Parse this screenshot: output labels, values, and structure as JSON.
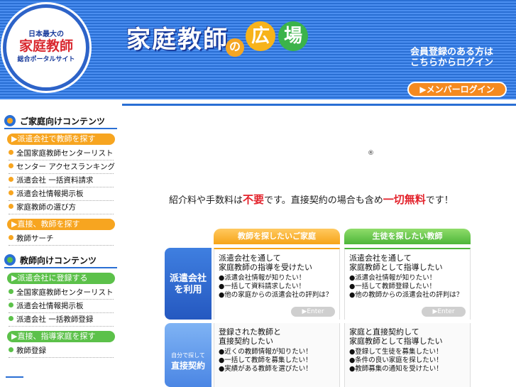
{
  "header": {
    "logo": {
      "top": "日本最大の",
      "main": "家庭教師",
      "sub": "総合ポータルサイト"
    },
    "title": "家庭教師",
    "title_no": "の",
    "title_hiroba": [
      "広",
      "場"
    ],
    "login_msg": [
      "会員登録のある方は",
      "こちらからログイン"
    ],
    "member_login": "▶メンバーログイン"
  },
  "sidebar": {
    "family_section": "ご家庭向けコンテンツ",
    "family_bar1": "▶派遣会社で教師を探す",
    "family_items1": [
      "全国家庭教師センターリスト",
      "センター アクセスランキング",
      "派遣会社 一括資料請求",
      "派遣会社情報掲示板",
      "家庭教師の選び方"
    ],
    "family_bar2": "▶直接、教師を探す",
    "family_items2": [
      "教師サーチ"
    ],
    "teacher_section": "教師向けコンテンツ",
    "teacher_bar1": "▶派遣会社に登録する",
    "teacher_items1": [
      "全国家庭教師センターリスト",
      "派遣会社情報掲示板",
      "派遣会社 一括教師登録"
    ],
    "teacher_bar2": "▶直接、指導家庭を探す",
    "teacher_items2": [
      "教師登録"
    ]
  },
  "main": {
    "reg_mark": "®",
    "headline": {
      "a": "紹介料や手数料は",
      "b": "不要",
      "c": "です。直接契約の場合も含め",
      "d": "一切無料",
      "e": "です！"
    },
    "tab_family": "教師を探したいご家庭",
    "tab_teacher": "生徒を探したい教師",
    "row1_label": [
      "派遣会社",
      "を利用"
    ],
    "row2_label_small": "自分で探して",
    "row2_label_big": "直接契約",
    "c1": {
      "title": [
        "派遣会社を通して",
        "家庭教師の指導を受けたい"
      ],
      "lines": [
        "●派遣会社情報が知りたい！",
        "●一括して資料請求したい！",
        "●他の家庭からの派遣会社の評判は？"
      ],
      "enter": "▶Enter"
    },
    "c2": {
      "title": [
        "派遣会社を通して",
        "家庭教師として指導したい"
      ],
      "lines": [
        "●派遣会社情報が知りたい！",
        "●一括して教師登録したい！",
        "●他の教師からの派遣会社の評判は？"
      ],
      "enter": "▶Enter"
    },
    "c3": {
      "title": [
        "登録された教師と",
        "直接契約したい"
      ],
      "lines": [
        "●近くの教師情報が知りたい！",
        "●一括して教師を募集したい！",
        "●実績がある教師を選びたい！"
      ]
    },
    "c4": {
      "title": [
        "家庭と直接契約して",
        "家庭教師として指導したい"
      ],
      "lines": [
        "●登録して生徒を募集したい！",
        "●条件の良い家庭を探したい！",
        "●教師募集の通知を受けたい！"
      ]
    }
  },
  "colors": {
    "blue": "#2a6fd4",
    "orange": "#f7a520",
    "green": "#5cc14a",
    "red": "#e3232c"
  }
}
